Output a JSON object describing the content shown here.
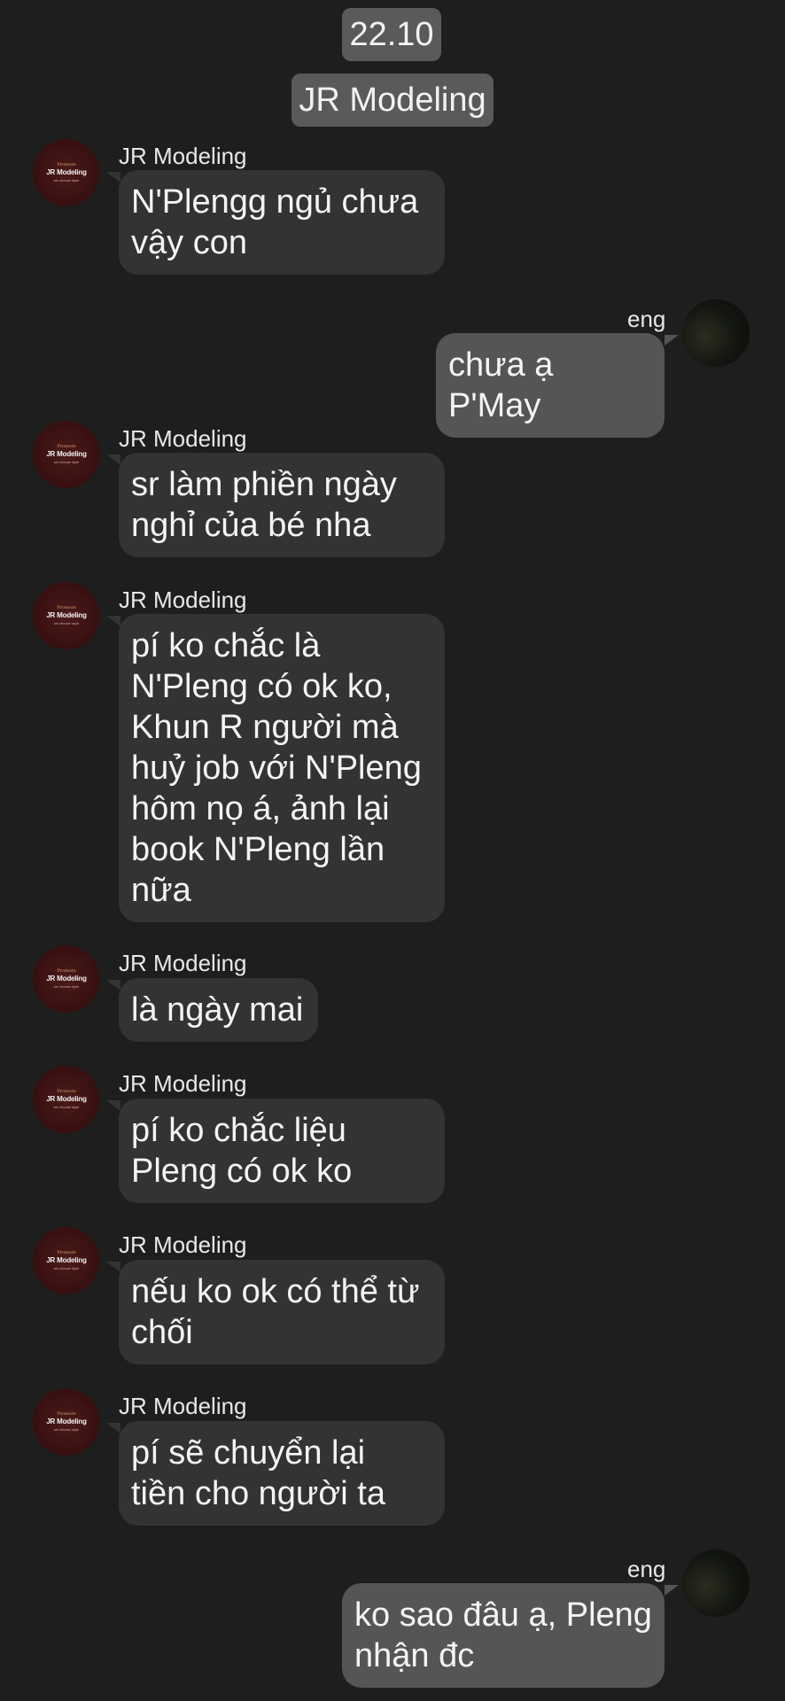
{
  "header": {
    "date": "22.10",
    "group_name": "JR Modeling"
  },
  "contact_avatar": {
    "line_top": "Promote",
    "line_mid": "JR Modeling",
    "line_bottom": "we choose style"
  },
  "messages": [
    {
      "side": "in",
      "sender": "JR Modeling",
      "text": "N'Plengg ngủ chưa\nvậy con"
    },
    {
      "side": "out",
      "sender": "eng",
      "text": "chưa ạ P'May"
    },
    {
      "side": "in",
      "sender": "JR Modeling",
      "text": "sr làm phiền ngày\nnghỉ của bé nha"
    },
    {
      "side": "in",
      "sender": "JR Modeling",
      "text": "pí ko chắc là\nN'Pleng có ok ko,\nKhun R người mà\nhuỷ job với N'Pleng\nhôm nọ á, ảnh lại\nbook N'Pleng lần\nnữa"
    },
    {
      "side": "in",
      "sender": "JR Modeling",
      "text": "là ngày mai"
    },
    {
      "side": "in",
      "sender": "JR Modeling",
      "text": "pí ko chắc liệu\nPleng có ok ko"
    },
    {
      "side": "in",
      "sender": "JR Modeling",
      "text": "nếu ko ok có thể từ\nchối"
    },
    {
      "side": "in",
      "sender": "JR Modeling",
      "text": "pí sẽ chuyển lại\ntiền cho người ta"
    },
    {
      "side": "out",
      "sender": "eng",
      "text": "ko sao đâu ạ, Pleng\nnhận đc"
    }
  ]
}
